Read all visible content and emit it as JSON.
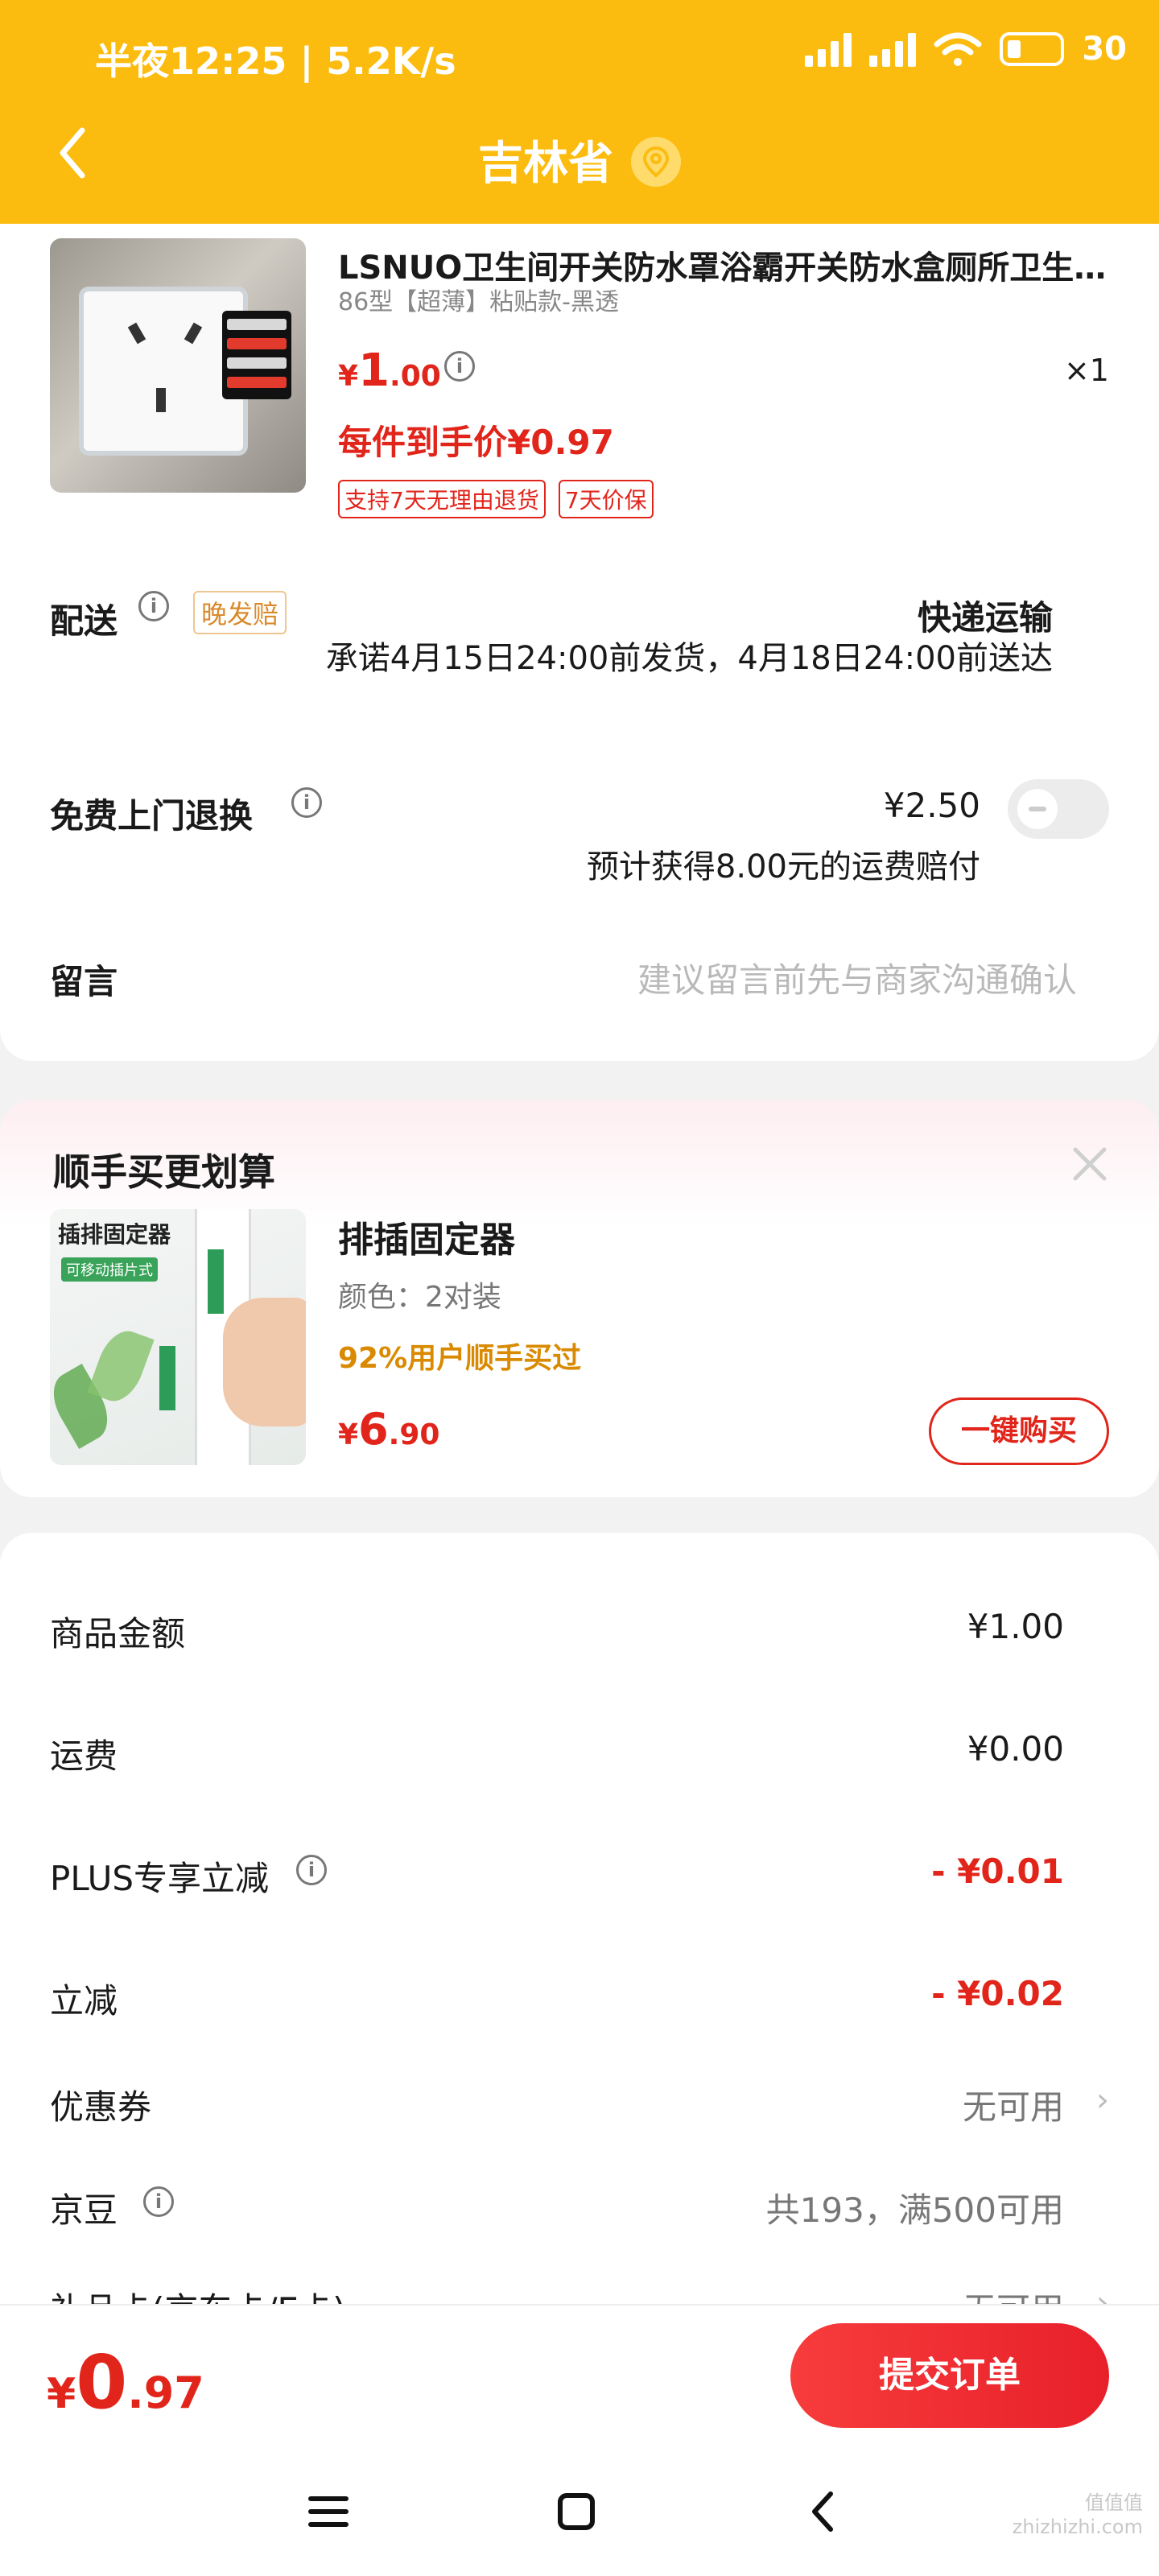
{
  "status_bar": {
    "time": "半夜12:25 | 5.2K/s",
    "battery": "30"
  },
  "header": {
    "title": "吉林省"
  },
  "product": {
    "title": "LSNUO卫生间开关防水罩浴霸开关防水盒厕所卫生间墙壁插座",
    "spec": "86型【超薄】粘贴款-黑透",
    "price_symbol": "¥",
    "price_int": "1",
    "price_dec": ".00",
    "qty": "×1",
    "arrival_price": "每件到手价¥0.97",
    "badges": [
      "支持7天无理由退货",
      "7天价保"
    ]
  },
  "delivery": {
    "label": "配送",
    "badge": "晚发赔",
    "method": "快递运输",
    "promise": "承诺4月15日24:00前发货，4月18日24:00前送达"
  },
  "return_service": {
    "label": "免费上门退换",
    "fee": "¥2.50",
    "note": "预计获得8.00元的运费赔付",
    "enabled": false
  },
  "message": {
    "label": "留言",
    "placeholder": "建议留言前先与商家沟通确认"
  },
  "upsell": {
    "title": "顺手买更划算",
    "image_text": "插排固定器",
    "image_tag": "可移动插片式",
    "name": "排插固定器",
    "spec": "颜色：2对装",
    "social": "92%用户顺手买过",
    "price_symbol": "¥",
    "price_int": "6",
    "price_dec": ".90",
    "button": "一键购买"
  },
  "fees": {
    "goods_label": "商品金额",
    "goods_value": "¥1.00",
    "freight_label": "运费",
    "freight_value": "¥0.00",
    "plus_label": "PLUS专享立减",
    "plus_value": "- ¥0.01",
    "discount_label": "立减",
    "discount_value": "- ¥0.02",
    "coupon_label": "优惠券",
    "coupon_value": "无可用",
    "beans_label": "京豆",
    "beans_value": "共193，满500可用",
    "card_label": "礼品卡(京东卡/E卡)",
    "card_value": "无可用"
  },
  "footer": {
    "total_symbol": "¥",
    "total_int": "0",
    "total_dec": ".97",
    "submit": "提交订单",
    "watermark_1": "值值值",
    "watermark_2": "zhizhizhi.com"
  },
  "colors": {
    "header": "#fcbc0f",
    "accent_red": "#e1251b",
    "orange": "#d98a00"
  }
}
